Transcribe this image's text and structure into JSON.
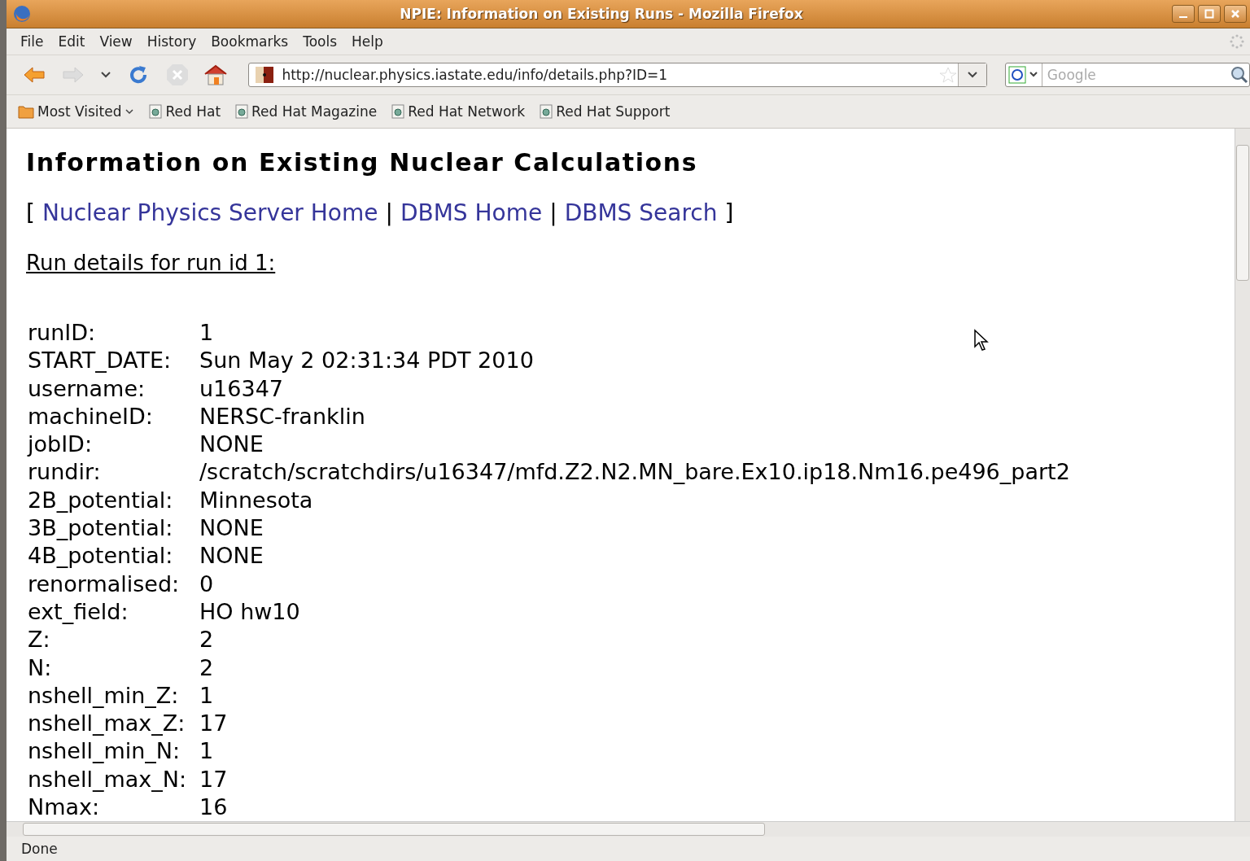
{
  "window": {
    "title": "NPIE: Information on Existing Runs - Mozilla Firefox"
  },
  "menu": [
    "File",
    "Edit",
    "View",
    "History",
    "Bookmarks",
    "Tools",
    "Help"
  ],
  "toolbar": {
    "url": "http://nuclear.physics.iastate.edu/info/details.php?ID=1",
    "search_placeholder": "Google"
  },
  "bookmarks": [
    {
      "label": "Most Visited",
      "kind": "folder"
    },
    {
      "label": "Red Hat",
      "kind": "link"
    },
    {
      "label": "Red Hat Magazine",
      "kind": "link"
    },
    {
      "label": "Red Hat Network",
      "kind": "link"
    },
    {
      "label": "Red Hat Support",
      "kind": "link"
    }
  ],
  "page": {
    "heading": "Information on Existing Nuclear Calculations",
    "nav": [
      {
        "kind": "text",
        "text": "["
      },
      {
        "kind": "link",
        "text": "Nuclear Physics Server Home"
      },
      {
        "kind": "text",
        "text": "|"
      },
      {
        "kind": "link",
        "text": "DBMS Home"
      },
      {
        "kind": "text",
        "text": "|"
      },
      {
        "kind": "link",
        "text": "DBMS Search"
      },
      {
        "kind": "text",
        "text": "]"
      }
    ],
    "subheading": "Run details for run id 1:",
    "fields": [
      {
        "label": "runID:",
        "value": "1"
      },
      {
        "label": "START_DATE:",
        "value": "Sun May 2 02:31:34 PDT 2010"
      },
      {
        "label": "username:",
        "value": "u16347"
      },
      {
        "label": "machineID:",
        "value": "NERSC-franklin"
      },
      {
        "label": "jobID:",
        "value": "NONE"
      },
      {
        "label": "rundir:",
        "value": "/scratch/scratchdirs/u16347/mfd.Z2.N2.MN_bare.Ex10.ip18.Nm16.pe496_part2"
      },
      {
        "label": "2B_potential:",
        "value": "Minnesota"
      },
      {
        "label": "3B_potential:",
        "value": "NONE"
      },
      {
        "label": "4B_potential:",
        "value": "NONE"
      },
      {
        "label": "renormalised:",
        "value": "0"
      },
      {
        "label": "ext_field:",
        "value": "HO hw10"
      },
      {
        "label": "Z:",
        "value": "2"
      },
      {
        "label": "N:",
        "value": "2"
      },
      {
        "label": "nshell_min_Z:",
        "value": "1"
      },
      {
        "label": "nshell_max_Z:",
        "value": "17"
      },
      {
        "label": "nshell_min_N:",
        "value": "1"
      },
      {
        "label": "nshell_max_N:",
        "value": "17"
      },
      {
        "label": "Nmax:",
        "value": "16"
      }
    ]
  },
  "status_bar": "Done"
}
